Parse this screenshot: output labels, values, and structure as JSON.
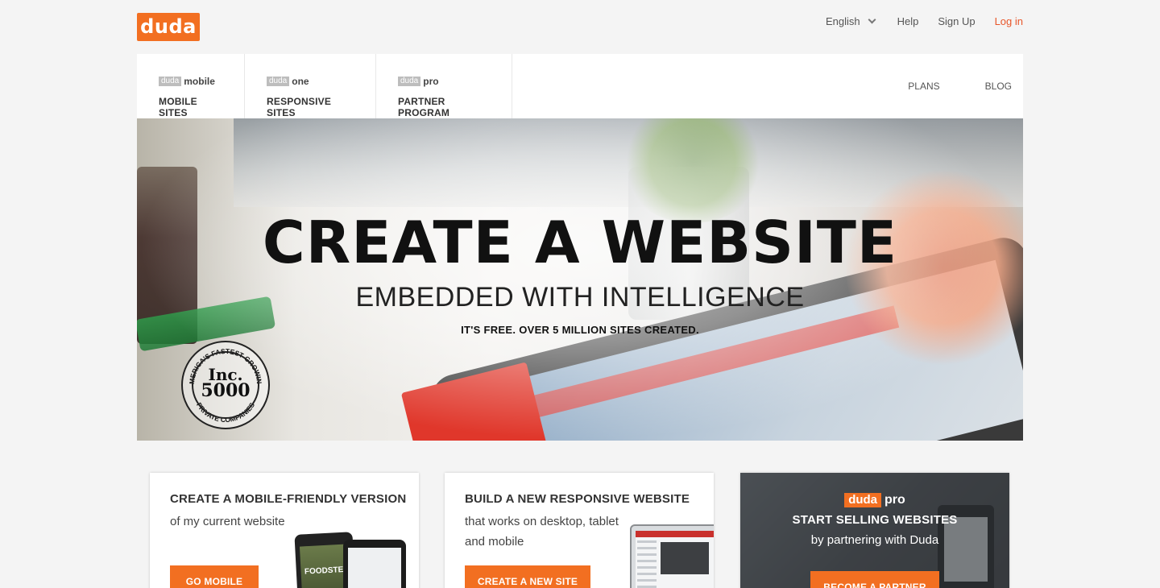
{
  "brand": {
    "logo_text": "duda",
    "accent": "#f26f21"
  },
  "topnav": {
    "language": "English",
    "help": "Help",
    "signup": "Sign Up",
    "login": "Log in"
  },
  "products": [
    {
      "tag": "duda",
      "name": "mobile",
      "title": "MOBILE SITES"
    },
    {
      "tag": "duda",
      "name": "one",
      "title": "RESPONSIVE SITES"
    },
    {
      "tag": "duda",
      "name": "pro",
      "title": "PARTNER PROGRAM"
    }
  ],
  "rightnav": {
    "plans": "PLANS",
    "blog": "BLOG"
  },
  "hero": {
    "title": "CREATE A WEBSITE",
    "subtitle": "EMBEDDED WITH INTELLIGENCE",
    "tagline": "IT'S FREE. OVER 5 MILLION SITES CREATED.",
    "seal": {
      "line1": "Inc.",
      "line2": "5000",
      "ring_top": "AMERICA'S FASTEST-GROWING",
      "ring_bottom": "PRIVATE COMPANIES"
    },
    "screen_text": "FOODSTEPS"
  },
  "cards": [
    {
      "heading": "CREATE A MOBILE-FRIENDLY VERSION",
      "body": "of my current website",
      "button": "GO MOBILE"
    },
    {
      "heading": "BUILD A NEW RESPONSIVE WEBSITE",
      "body": "that works on desktop, tablet and mobile",
      "button": "CREATE A NEW SITE"
    },
    {
      "brand_tag": "duda",
      "brand_name": "pro",
      "heading": "START SELLING WEBSITES",
      "body": "by partnering with Duda",
      "button": "BECOME A PARTNER"
    }
  ]
}
